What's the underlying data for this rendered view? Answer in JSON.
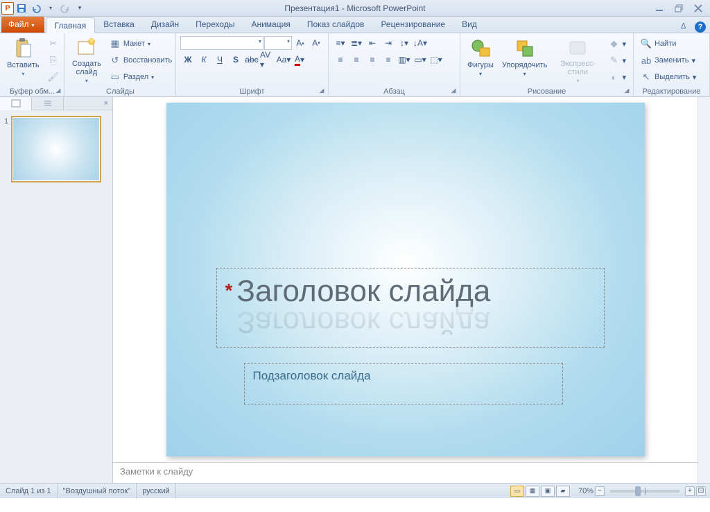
{
  "title": "Презентация1 - Microsoft PowerPoint",
  "tabs": {
    "file": "Файл",
    "list": [
      "Главная",
      "Вставка",
      "Дизайн",
      "Переходы",
      "Анимация",
      "Показ слайдов",
      "Рецензирование",
      "Вид"
    ],
    "active": 0
  },
  "ribbon": {
    "clipboard": {
      "label": "Буфер обм...",
      "paste": "Вставить"
    },
    "slides": {
      "label": "Слайды",
      "new_slide": "Создать\nслайд",
      "layout": "Макет",
      "reset": "Восстановить",
      "section": "Раздел"
    },
    "font": {
      "label": "Шрифт",
      "fontname": "",
      "fontsize": ""
    },
    "paragraph": {
      "label": "Абзац"
    },
    "drawing": {
      "label": "Рисование",
      "shapes": "Фигуры",
      "arrange": "Упорядочить",
      "quick_styles": "Экспресс-стили"
    },
    "editing": {
      "label": "Редактирование",
      "find": "Найти",
      "replace": "Заменить",
      "select": "Выделить"
    }
  },
  "slide": {
    "title_placeholder": "Заголовок слайда",
    "subtitle_placeholder": "Подзаголовок слайда"
  },
  "thumbs": {
    "items": [
      {
        "num": "1"
      }
    ]
  },
  "notes_placeholder": "Заметки к слайду",
  "status": {
    "slide_of": "Слайд 1 из 1",
    "theme": "\"Воздушный поток\"",
    "lang": "русский",
    "zoom": "70%"
  }
}
